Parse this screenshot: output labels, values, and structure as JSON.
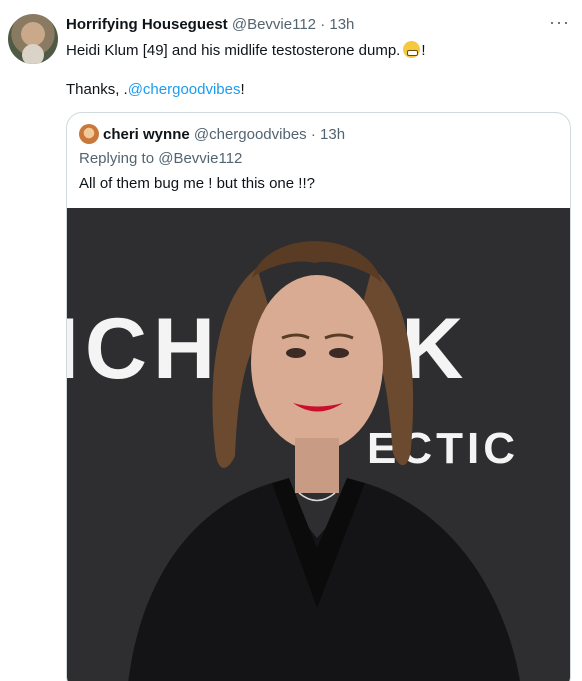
{
  "tweet": {
    "author_name": "Horrifying Houseguest",
    "author_handle": "@Bevvie112",
    "separator": "·",
    "time": "13h",
    "more": "···",
    "text_line1_before": "Heidi Klum [49] and his midlife testosterone dump.",
    "text_line1_after": "!",
    "text_line2_before": "Thanks, .",
    "text_line2_link": "@chergoodvibes",
    "text_line2_after": "!",
    "emoji_icon": "grimace-emoji-icon"
  },
  "quoted_tweet": {
    "author_name": "cheri wynne",
    "author_handle": "@chergoodvibes",
    "separator": "·",
    "time": "13h",
    "replying_to": "Replying to @Bevvie112",
    "text": "All of them bug me ! but this one !!?"
  },
  "photo": {
    "backdrop_text_top": "ICH  EL K",
    "backdrop_text_bottom": "ECTIC",
    "colors": {
      "backdrop": "#2e2e30",
      "lettering": "#f4f4f4",
      "jacket": "#141416",
      "hair": "#6b4a2f",
      "skin": "#d8ab92",
      "lips": "#c8102e"
    }
  }
}
